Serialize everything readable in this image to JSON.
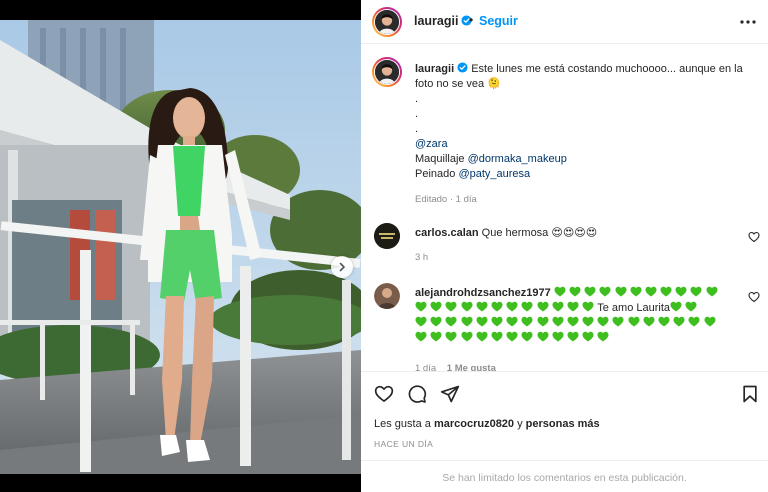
{
  "post": {
    "username": "lauragii",
    "follow_label": "Seguir",
    "dot": "•",
    "caption": {
      "username": "lauragii",
      "text": "Este lunes me está costando muchoooo... aunque en la foto no se vea 🫠",
      "dots": [
        ".",
        ".",
        "."
      ],
      "zara": "@zara",
      "makeup_prefix": "Maquillaje ",
      "makeup_mention": "@dormaka_makeup",
      "hair_prefix": "Peinado ",
      "hair_mention": "@paty_auresa",
      "meta": "Editado · 1 día"
    },
    "comments": [
      {
        "username": "carlos.calan",
        "text": "Que hermosa",
        "emoji": "😍😍😍😍",
        "time": "3 h"
      },
      {
        "username": "alejandrohdzsanchez1977",
        "text_mid": "Te amo Laurita",
        "heart_color": "#3fbf1f",
        "time": "1 día",
        "likes": "1 Me gusta"
      }
    ],
    "likes_text": "Les gusta a",
    "likes_user": "marcocruz0820",
    "likes_and": "y",
    "likes_others": "personas más",
    "time_ago": "HACE UN DÍA",
    "comments_limited": "Se han limitado los comentarios en esta publicación."
  },
  "colors": {
    "link": "#0095f6",
    "mention": "#00376b",
    "muted": "#8e8e8e"
  }
}
